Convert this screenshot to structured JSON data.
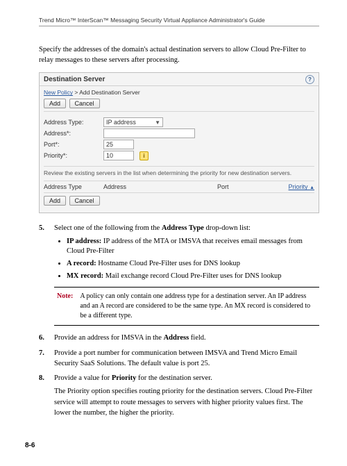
{
  "header": {
    "running_head": "Trend Micro™ InterScan™ Messaging Security Virtual Appliance Administrator's Guide"
  },
  "intro": "Specify the addresses of the domain's actual destination servers to allow Cloud Pre-Filter to relay messages to these servers after processing.",
  "figure": {
    "title": "Destination Server",
    "breadcrumb_link": "New Policy",
    "breadcrumb_tail": "Add Destination Server",
    "add_btn": "Add",
    "cancel_btn": "Cancel",
    "labels": {
      "address_type": "Address Type:",
      "address": "Address*:",
      "port": "Port*:",
      "priority": "Priority*:"
    },
    "values": {
      "address_type": "IP address",
      "address": "",
      "port": "25",
      "priority": "10"
    },
    "hint": "Review the existing servers in the list when determining the priority for new destination servers.",
    "table": {
      "h1": "Address Type",
      "h2": "Address",
      "h3": "Port",
      "h4": "Priority"
    }
  },
  "steps": {
    "s5": {
      "lead": "Select one of the following from the ",
      "bold": "Address Type",
      "tail": " drop-down list:",
      "bullets": {
        "ip": {
          "b": "IP address:",
          "t": " IP address of the MTA or IMSVA that receives email messages from Cloud Pre-Filter"
        },
        "a": {
          "b": "A record:",
          "t": " Hostname Cloud Pre-Filter uses for DNS lookup"
        },
        "mx": {
          "b": "MX record:",
          "t": " Mail exchange record Cloud Pre-Filter uses for DNS lookup"
        }
      }
    },
    "note": {
      "label": "Note:",
      "text": "A policy can only contain one address type for a destination server. An IP address and an A record are considered to be the same type. An MX record is considered to be a different type."
    },
    "s6": {
      "lead": "Provide an address for IMSVA in the ",
      "bold": "Address",
      "tail": " field."
    },
    "s7": "Provide a port number for communication between IMSVA and Trend Micro Email Security SaaS Solutions. The default value is port 25.",
    "s8": {
      "lead": "Provide a value for ",
      "bold": "Priority",
      "tail": " for the destination server.",
      "para": "The Priority option specifies routing priority for the destination servers. Cloud Pre-Filter service will attempt to route messages to servers with higher priority values first. The lower the number, the higher the priority."
    }
  },
  "pageno": "8-6"
}
